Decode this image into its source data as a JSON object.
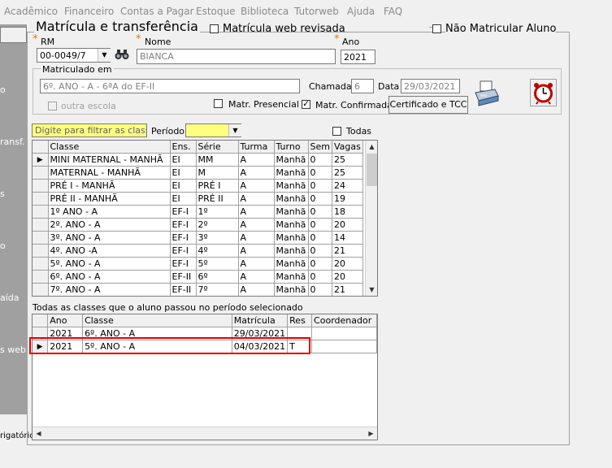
{
  "menu": [
    "Acadêmico",
    "Financeiro",
    "Contas a Pagar",
    "Estoque",
    "Biblioteca",
    "Tutorweb",
    "Ajuda",
    "FAQ"
  ],
  "sidebar": [
    "o",
    "ransf.",
    "s",
    "o",
    "aída",
    "s web",
    "rigatório"
  ],
  "title": "Matrícula e transferência",
  "chk_web": "Matrícula web revisada",
  "chk_nao_matricular": "Não Matricular Aluno",
  "rm": {
    "label": "RM",
    "value": "00-0049/7"
  },
  "nome": {
    "label": "Nome",
    "value": "BIANCA"
  },
  "ano": {
    "label": "Ano",
    "value": "2021"
  },
  "matriculado": {
    "label": "Matriculado em",
    "value": "6º. ANO  - A - 6ªA do EF-II",
    "chamada_label": "Chamada",
    "chamada_value": "6",
    "data_label": "Data",
    "data_value": "29/03/2021",
    "outra_escola": "outra escola",
    "matr_presencial": "Matr. Presencial",
    "matr_confirmada": "Matr. Confirmada",
    "cert_button": "Certificado e TCC"
  },
  "filter_placeholder": "Digite para filtrar as classes",
  "periodo_label": "Período",
  "todas_label": "Todas",
  "classes": {
    "headers": [
      "Classe",
      "Ens.",
      "Série",
      "Turma",
      "Turno",
      "Sem",
      "Vagas"
    ],
    "rows": [
      [
        "MINI MATERNAL - MANHÃ",
        "EI",
        "MM",
        "A",
        "Manhã",
        "0",
        "25"
      ],
      [
        "MATERNAL  - MANHÃ",
        "EI",
        "M",
        "A",
        "Manhã",
        "0",
        "25"
      ],
      [
        "PRÉ  I  - MANHÃ",
        "EI",
        "PRÉ I",
        "A",
        "Manhã",
        "0",
        "24"
      ],
      [
        "PRÉ  II  - MANHÃ",
        "EI",
        "PRÉ II",
        "A",
        "Manhã",
        "0",
        "19"
      ],
      [
        "1º ANO - A",
        "EF-I",
        "1º",
        "A",
        "Manhã",
        "0",
        "18"
      ],
      [
        "2º. ANO  - A",
        "EF-I",
        "2º",
        "A",
        "Manhã",
        "0",
        "20"
      ],
      [
        "3º. ANO  - A",
        "EF-I",
        "3º",
        "A",
        "Manhã",
        "0",
        "14"
      ],
      [
        "4º. ANO  -A",
        "EF-I",
        "4º",
        "A",
        "Manhã",
        "0",
        "21"
      ],
      [
        "5º. ANO  -  A",
        "EF-I",
        "5º",
        "A",
        "Manhã",
        "0",
        "20"
      ],
      [
        "6º. ANO  - A",
        "EF-II",
        "6º",
        "A",
        "Manhã",
        "0",
        "20"
      ],
      [
        "7º. ANO  - A",
        "EF-II",
        "7º",
        "A",
        "Manhã",
        "0",
        "21"
      ]
    ]
  },
  "history_label": "Todas as classes que o aluno passou no período selecionado",
  "history": {
    "headers": [
      "Ano",
      "Classe",
      "Matrícula",
      "Res",
      "Coordenador"
    ],
    "rows": [
      [
        "2021",
        "6º. ANO  - A",
        "29/03/2021",
        "",
        ""
      ],
      [
        "2021",
        "5º. ANO  -  A",
        "04/03/2021",
        "T",
        ""
      ]
    ]
  },
  "colors": {
    "highlight_red": "#e00000",
    "filter_yellow": "#ffff80"
  }
}
